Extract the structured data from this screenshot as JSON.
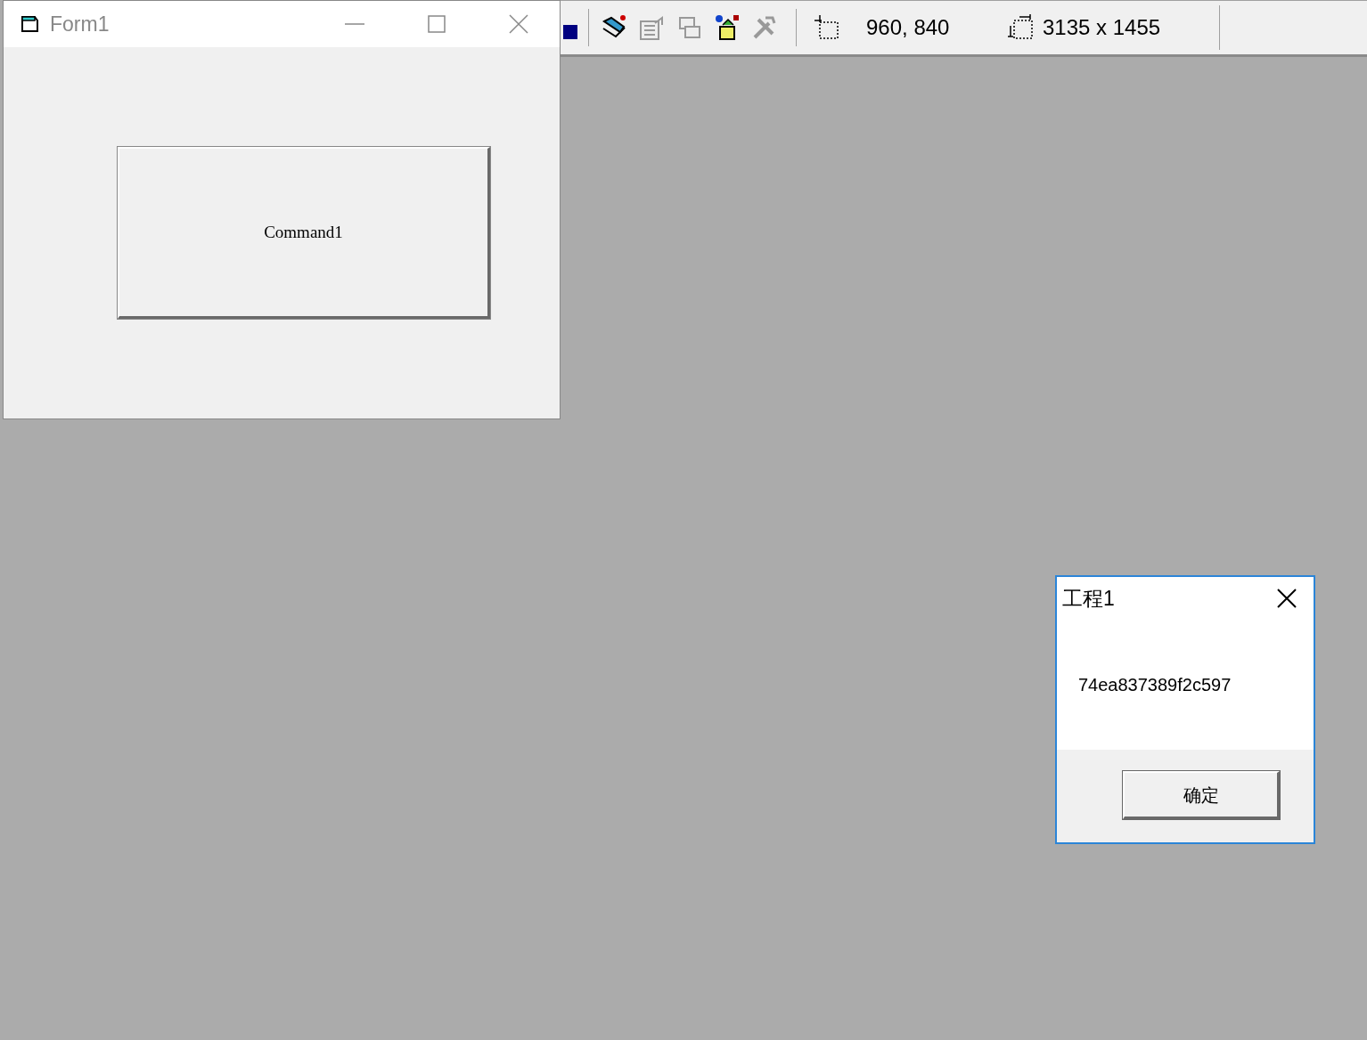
{
  "toolbar": {
    "position": "960, 840",
    "size": "3135 x 1455"
  },
  "form_window": {
    "title": "Form1",
    "command_button": "Command1"
  },
  "message_box": {
    "title": "工程1",
    "message": "74ea837389f2c597",
    "ok_button": "确定"
  }
}
